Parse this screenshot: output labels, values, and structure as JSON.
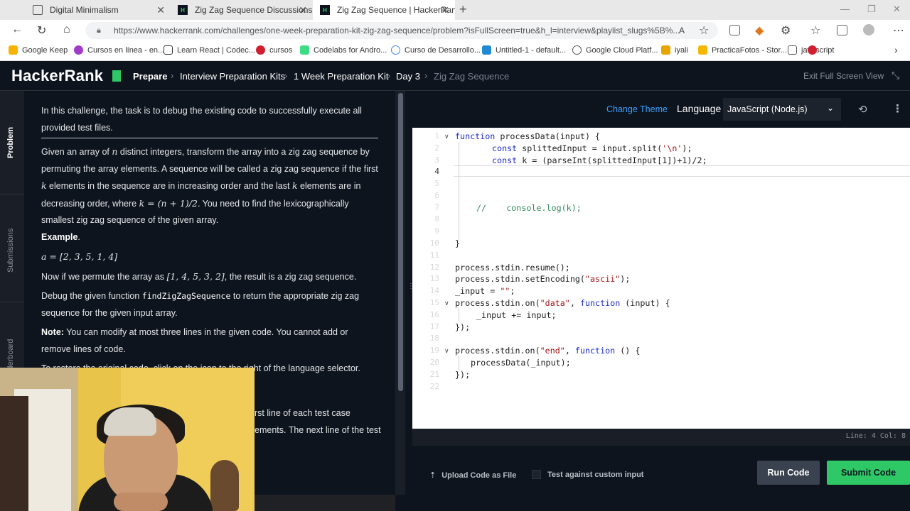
{
  "browser": {
    "tabs": [
      {
        "title": "Digital Minimalism",
        "active": false
      },
      {
        "title": "Zig Zag Sequence Discussions | A",
        "active": false
      },
      {
        "title": "Zig Zag Sequence | HackerRank",
        "active": true
      }
    ],
    "url": "https://www.hackerrank.com/challenges/one-week-preparation-kit-zig-zag-sequence/problem?isFullScreen=true&h_l=interview&playlist_slugs%5B%...",
    "bookmarks": [
      "Google Keep",
      "Cursos en línea - en...",
      "Learn React | Codec...",
      "cursos",
      "Codelabs for Andro...",
      "Curso de Desarrollo...",
      "Untitled-1 - default...",
      "Google Cloud Platf...",
      "iyali",
      "PracticaFotos - Stor...",
      "javascript"
    ]
  },
  "header": {
    "logo": "HackerRank",
    "breadcrumb": [
      "Prepare",
      "Interview Preparation Kits",
      "1 Week Preparation Kit",
      "Day 3",
      "Zig Zag Sequence"
    ],
    "exit_fullscreen": "Exit Full Screen View"
  },
  "rail": {
    "problem": "Problem",
    "submissions": "Submissions",
    "leaderboard": "Leaderboard"
  },
  "problem": {
    "intro": "In this challenge, the task is to debug the existing code to successfully execute all provided test files.",
    "desc_1": "Given an array of ",
    "desc_n": "n",
    "desc_2": " distinct integers, transform the array into a zig zag sequence by permuting the array elements. A sequence will be called a zig zag sequence if the first ",
    "desc_k1": "k",
    "desc_3": " elements in the sequence are in increasing order and the last ",
    "desc_k2": "k",
    "desc_4": " elements are in decreasing order, where ",
    "desc_formula": "k = (n + 1)/2",
    "desc_5": ". You need to find the lexicographically smallest zig zag sequence of the given array.",
    "example_label": "Example",
    "example_period": ".",
    "example_array": "a = [2, 3, 5, 1, 4]",
    "permute_1": "Now if we permute the array as ",
    "permute_array": "[1, 4, 5, 3, 2]",
    "permute_2": ", the result is a zig zag sequence.",
    "debug_1": "Debug the given function ",
    "debug_fn": "findZigZagSequence",
    "debug_2": " to return the appropriate zig zag sequence for the given input array.",
    "note_label": "Note:",
    "note_text": " You can modify at most three lines in the given code. You cannot add or remove lines of code.",
    "restore": "To restore the original code, click on the icon to the right of the language selector.",
    "input_frag_1": "rst line of each test case",
    "input_frag_2": "ements. The next line of the test"
  },
  "editor": {
    "change_theme": "Change Theme",
    "language_label": "Language",
    "language": "JavaScript (Node.js)",
    "current_line_number": "4",
    "status": "Line: 4 Col: 8",
    "code": {
      "l1_kw": "function",
      "l1": " processData(input) {",
      "l2_kw": "const",
      "l2_a": " splittedInput = input.split(",
      "l2_str": "'\\n'",
      "l2_b": ");",
      "l3_kw": "const",
      "l3": " k = (parseInt(splittedInput[1])+1)/2;",
      "l7": "//    console.log(k);",
      "l10": "}",
      "l12": "process.stdin.resume();",
      "l13_a": "process.stdin.setEncoding(",
      "l13_str": "\"ascii\"",
      "l13_b": ");",
      "l14_a": "_input = ",
      "l14_str": "\"\"",
      "l14_b": ";",
      "l15_a": "process.stdin.on(",
      "l15_str": "\"data\"",
      "l15_b": ", ",
      "l15_kw": "function",
      "l15_c": " (input) {",
      "l16": "_input += input;",
      "l17": "});",
      "l19_a": "process.stdin.on(",
      "l19_str": "\"end\"",
      "l19_b": ", ",
      "l19_kw": "function",
      "l19_c": " () {",
      "l20": "processData(_input);",
      "l21": "});"
    }
  },
  "footer": {
    "upload": "Upload Code as File",
    "custom_input": "Test against custom input",
    "run": "Run Code",
    "submit": "Submit Code"
  },
  "colors": {
    "accent_green": "#2ec866",
    "header_bg": "#0e141e",
    "link_blue": "#39a0ff"
  }
}
